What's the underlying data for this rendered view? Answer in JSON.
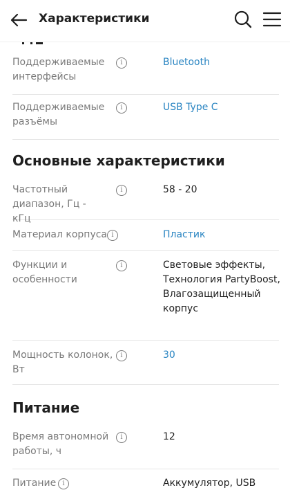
{
  "header": {
    "title": "Характеристики"
  },
  "sections": {
    "main_title": "Основные характеристики",
    "power_title": "Питание"
  },
  "rows": {
    "interfaces": {
      "label": "Поддерживаемые интерфейсы",
      "value": "Bluetooth"
    },
    "connectors": {
      "label": "Поддерживаемые разъёмы",
      "value": "USB Type C"
    },
    "freq": {
      "label": "Частотный диапазон, Гц - кГц",
      "value": "58 - 20"
    },
    "material": {
      "label": "Материал корпуса",
      "value": "Пластик"
    },
    "features": {
      "label": "Функции и особенности",
      "value": "Световые эффекты, Технология PartyBoost, Влагозащищенный корпус"
    },
    "power": {
      "label": "Мощность колонок, Вт",
      "value": "30"
    },
    "battery": {
      "label": "Время автономной работы, ч",
      "value": "12"
    },
    "next": {
      "label": "Питание",
      "value": "Аккумулятор, USB"
    }
  },
  "colors": {
    "link": "#2a85c2",
    "label": "#7a7a7a",
    "text": "#1f1f1f"
  }
}
